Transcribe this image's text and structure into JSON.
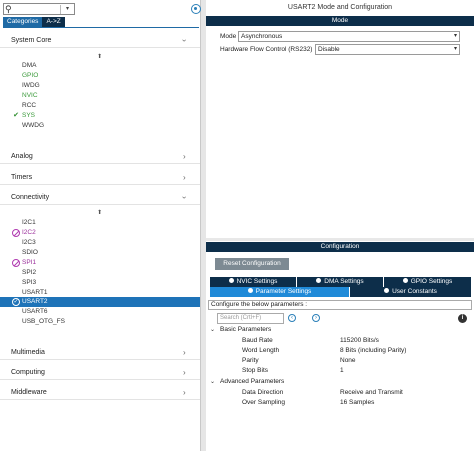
{
  "left": {
    "search": {
      "placeholder": ""
    },
    "tabs": [
      {
        "label": "Categories"
      },
      {
        "label": "A->Z"
      }
    ],
    "categories": {
      "system_core": "System Core",
      "analog": "Analog",
      "timers": "Timers",
      "connectivity": "Connectivity",
      "multimedia": "Multimedia",
      "computing": "Computing",
      "middleware": "Middleware"
    },
    "system_core_items": [
      "DMA",
      "GPIO",
      "IWDG",
      "NVIC",
      "RCC",
      "SYS",
      "WWDG"
    ],
    "connectivity_items": [
      "I2C1",
      "I2C2",
      "I2C3",
      "SDIO",
      "SPI1",
      "SPI2",
      "SPI3",
      "USART1",
      "USART2",
      "USART6",
      "USB_OTG_FS"
    ]
  },
  "right": {
    "title": "USART2 Mode and Configuration",
    "mode_band": "Mode",
    "mode_label": "Mode",
    "mode_value": "Asynchronous",
    "hfc_label": "Hardware Flow Control (RS232)",
    "hfc_value": "Disable",
    "config_band": "Configuration",
    "reset_label": "Reset Configuration",
    "settings_tabs": [
      {
        "label": "NVIC Settings"
      },
      {
        "label": "DMA Settings"
      },
      {
        "label": "GPIO Settings"
      },
      {
        "label": "Parameter Settings"
      },
      {
        "label": "User Constants"
      }
    ],
    "config_hint": "Configure the below parameters :",
    "param_search_placeholder": "Search (Crtl+F)",
    "groups": {
      "basic": "Basic Parameters",
      "advanced": "Advanced Parameters"
    },
    "basic_params": [
      {
        "label": "Baud Rate",
        "value": "115200 Bits/s"
      },
      {
        "label": "Word Length",
        "value": "8 Bits (including Parity)"
      },
      {
        "label": "Parity",
        "value": "None"
      },
      {
        "label": "Stop Bits",
        "value": "1"
      }
    ],
    "advanced_params": [
      {
        "label": "Data Direction",
        "value": "Receive and Transmit"
      },
      {
        "label": "Over Sampling",
        "value": "16 Samples"
      }
    ]
  }
}
